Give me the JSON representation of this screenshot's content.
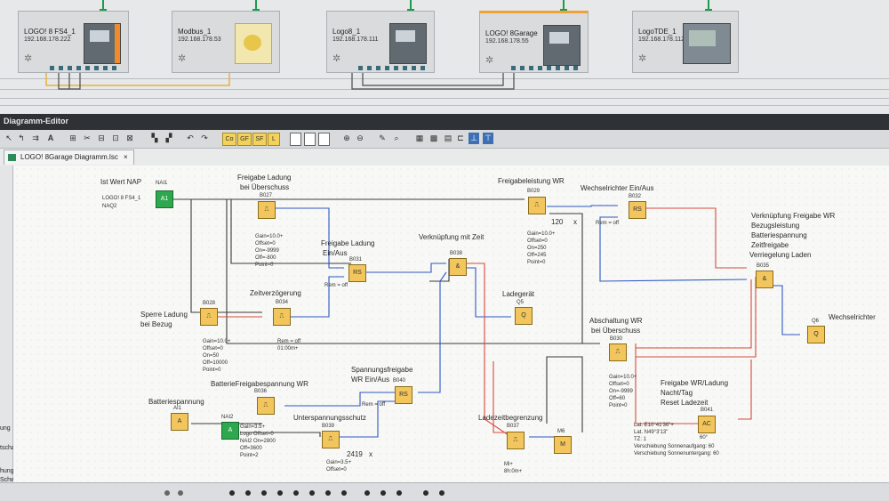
{
  "network": {
    "devices": [
      {
        "name": "LOGO! 8 FS4_1",
        "ip": "192.168.178.222"
      },
      {
        "name": "Modbus_1",
        "ip": "192.168.178.53"
      },
      {
        "name": "Logo8_1",
        "ip": "192.168.178.111"
      },
      {
        "name": "LOGO! 8Garage",
        "ip": "192.168.178.55"
      },
      {
        "name": "LogoTDE_1",
        "ip": "192.168.178.112"
      }
    ]
  },
  "editor": {
    "title": "Diagramm-Editor",
    "tab": "LOGO! 8Garage Diagramm.lsc",
    "toolbar": {
      "co": "Co",
      "gf": "GF",
      "sf": "SF",
      "l": "L"
    }
  },
  "left_panel": [
    "ung",
    "tschalte",
    "hung",
    "Schwellv"
  ],
  "diagram": {
    "labels": {
      "ist_wert": "Ist Wert NAP",
      "logo_fs4": "LOGO! 8 FS4_1",
      "naq2": "NAQ2",
      "freigabe_ladung": "Freigabe Ladung",
      "bei_ueberschuss": "bei Überschuss",
      "freigabe_ladung_ein": "Freigabe Ladung",
      "ein_aus": "Ein/Aus",
      "verknuepfung_zeit": "Verknüpfung mit Zeit",
      "freigabeleistung": "Freigabeleistung WR",
      "wechselrichter_einaus": "Wechselrichter Ein/Aus",
      "verknuepfung_freigabe": "Verknüpfung Freigabe WR",
      "bezugsleistung": "Bezugsleistung",
      "batteriespannung_t": "Batteriespannung",
      "zeitfreigabe": "Zeitfreigabe",
      "verriegelung_laden": "Verriegelung Laden",
      "sperre_ladung": "Sperre Ladung",
      "bei_bezug": "bei Bezug",
      "zeitverzoegerung": "Zeitverzögerung",
      "ladegeraet": "Ladegerät",
      "abschaltung_wr": "Abschaltung WR",
      "abschaltung_bei": "bei Überschuss",
      "wechselrichter": "Wechselrichter",
      "batteriefreigabe": "BatterieFreigabespannung WR",
      "spannungsfreigabe": "Spannungsfreigabe",
      "wr_einaus": "WR Ein/Aus",
      "batteriespannung": "Batteriespannung",
      "unterspannung": "Unterspannungsschutz",
      "ladezeitbegrenzung": "Ladezeitbegrenzung",
      "freigabe_wr_ladung": "Freigabe WR/Ladung",
      "nacht_tag": "Nacht/Tag",
      "reset_ladezeit": "Reset Ladezeit",
      "val_120": "120",
      "val_2419": "2419",
      "x1": "x",
      "x2": "x"
    },
    "blocks": {
      "nai1": "NAI1",
      "a1": "A1",
      "b027": "B027",
      "b031": "B031",
      "b038": "B038",
      "b029": "B029",
      "b032": "B032",
      "b035": "B035",
      "b028": "B028",
      "b034": "B034",
      "q5": "Q5",
      "b030": "B030",
      "q6": "Q6",
      "b036": "B036",
      "b040": "B040",
      "ai1": "AI1",
      "nai2": "NAI2",
      "b039": "B039",
      "b037": "B037",
      "m6": "M6",
      "b041": "B041"
    },
    "glyphs": {
      "rs": "RS",
      "amp": "&",
      "q": "Q",
      "a": "A",
      "ac": "AC",
      "m": "M"
    },
    "params": {
      "b027": [
        "Gain=10.0+",
        "Offset=0",
        "On=-9999",
        "Off=-800",
        "Point=0"
      ],
      "b031_rem": "Rem = off",
      "b032_rem": "Rem = off",
      "b029": [
        "Gain=10.0+",
        "Offset=0",
        "On=250",
        "Off=245",
        "Point=0"
      ],
      "b028": [
        "Gain=10.0+",
        "Offset=0",
        "On=50",
        "Off=10000",
        "Point=0"
      ],
      "b034": [
        "Rem = off",
        "01:00m+"
      ],
      "b030": [
        "Gain=10.0+",
        "Offset=0",
        "On=-9999",
        "Off=60",
        "Point=0"
      ],
      "b036": [
        "Gain=3.5+",
        "Logo Offset=0",
        "NAI2 On=2800",
        "Off=3600",
        "Point=2"
      ],
      "b040_rem": "Rem = off",
      "b039": [
        "Gain=3.5+",
        "Offset=0"
      ],
      "b037": [
        "Mi+",
        "8h:0m+"
      ],
      "b041": [
        "Lat. E10°41'36\"+",
        "Lat. N49°3'13\"",
        "TZ: 1",
        "Verschiebung Sonnenaufgang: 60",
        "Verschiebung Sonnenuntergang: 60"
      ],
      "b041_deg": "60°"
    }
  }
}
